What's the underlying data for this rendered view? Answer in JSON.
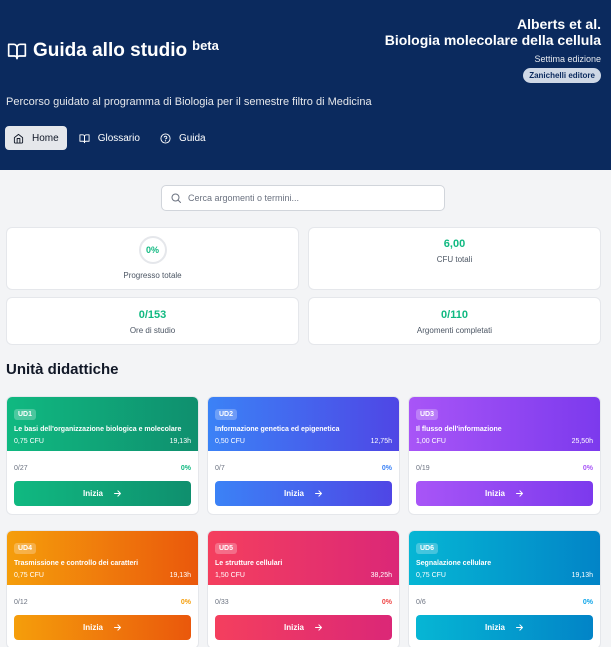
{
  "header": {
    "title": "Guida allo studio",
    "beta": "beta",
    "subtitle": "Percorso guidato al programma di Biologia per il semestre filtro di Medicina",
    "book": {
      "authors": "Alberts et al.",
      "title": "Biologia molecolare della cellula",
      "edition": "Settima edizione",
      "publisher": "Zanichelli editore"
    },
    "nav": [
      {
        "label": "Home",
        "icon": "home-icon",
        "active": true
      },
      {
        "label": "Glossario",
        "icon": "book-icon",
        "active": false
      },
      {
        "label": "Guida",
        "icon": "help-circle-icon",
        "active": false
      }
    ]
  },
  "search": {
    "placeholder": "Cerca argomenti o termini..."
  },
  "stats": {
    "progress": {
      "value": "0%",
      "label": "Progresso totale"
    },
    "cfu": {
      "value": "6,00",
      "label": "CFU totali"
    },
    "hours": {
      "value": "0/153",
      "label": "Ore di studio"
    },
    "topics": {
      "value": "0/110",
      "label": "Argomenti completati"
    }
  },
  "units_title": "Unità didattiche",
  "units": [
    {
      "code": "UD1",
      "title": "Le basi dell'organizzazione biologica e molecolare",
      "cfu": "0,75 CFU",
      "hours": "19,13h",
      "progress": "0/27",
      "percent": "0%",
      "button": "Inizia",
      "color": "#10b981"
    },
    {
      "code": "UD2",
      "title": "Informazione genetica ed epigenetica",
      "cfu": "0,50 CFU",
      "hours": "12,75h",
      "progress": "0/7",
      "percent": "0%",
      "button": "Inizia",
      "color": "#3b82f6"
    },
    {
      "code": "UD3",
      "title": "Il flusso dell'informazione",
      "cfu": "1,00 CFU",
      "hours": "25,50h",
      "progress": "0/19",
      "percent": "0%",
      "button": "Inizia",
      "color": "#a855f7"
    },
    {
      "code": "UD4",
      "title": "Trasmissione e controllo dei caratteri",
      "cfu": "0,75 CFU",
      "hours": "19,13h",
      "progress": "0/12",
      "percent": "0%",
      "button": "Inizia",
      "color": "#f59e0b"
    },
    {
      "code": "UD5",
      "title": "Le strutture cellulari",
      "cfu": "1,50 CFU",
      "hours": "38,25h",
      "progress": "0/33",
      "percent": "0%",
      "button": "Inizia",
      "color": "#f43f5e"
    },
    {
      "code": "UD6",
      "title": "Segnalazione cellulare",
      "cfu": "0,75 CFU",
      "hours": "19,13h",
      "progress": "0/6",
      "percent": "0%",
      "button": "Inizia",
      "color": "#06b6d4"
    }
  ]
}
